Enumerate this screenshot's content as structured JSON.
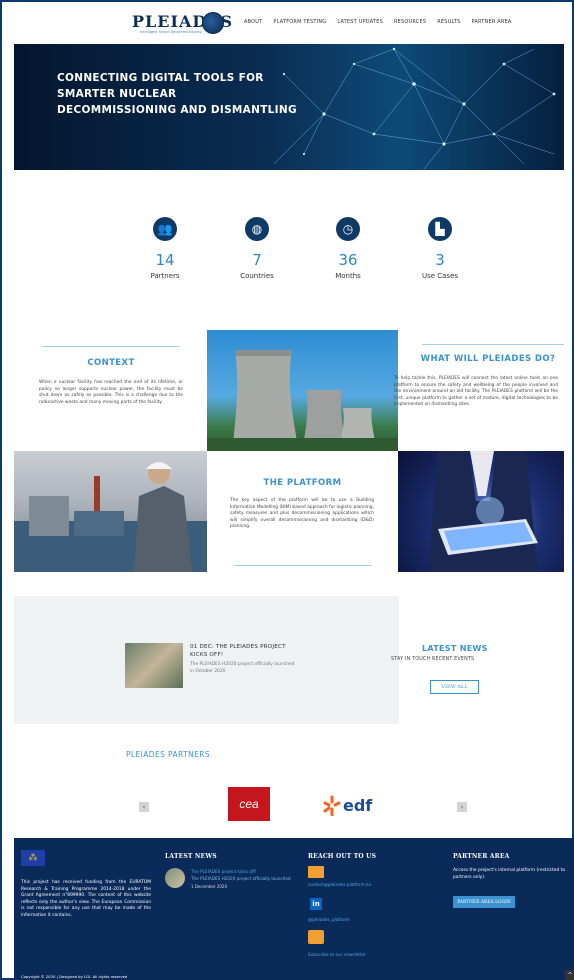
{
  "header": {
    "logo_text": "PLEIADES",
    "logo_tagline": "Intelligent Smart Decommissioning",
    "nav": [
      "ABOUT",
      "PLATFORM TESTING",
      "LATEST UPDATES",
      "RESOURCES",
      "RESULTS",
      "PARTNER AREA"
    ]
  },
  "hero": {
    "title": "CONNECTING DIGITAL TOOLS FOR SMARTER NUCLEAR DECOMMISSIONING AND DISMANTLING"
  },
  "stats": [
    {
      "icon": "people-icon",
      "num": "14",
      "label": "Partners"
    },
    {
      "icon": "globe-icon",
      "num": "7",
      "label": "Countries"
    },
    {
      "icon": "clock-icon",
      "num": "36",
      "label": "Months"
    },
    {
      "icon": "factory-icon",
      "num": "3",
      "label": "Use Cases"
    }
  ],
  "context": {
    "title": "CONTEXT",
    "text": "When a nuclear facility has reached the end of its lifetime, or policy no longer supports nuclear power, the facility must be shut down as safely as possible. This is a challenge due to the radioactive waste and many moving parts of the facility."
  },
  "what": {
    "title": "WHAT WILL PLEIADES DO?",
    "text": "To help tackle this, PLEIADES will connect the latest online tools on one platform to ensure the safety and wellbeing of the people involved and the environment around an old facility. The PLEIADES platform will be the first, unique platform to gather a set of mature, digital technologies to be implemented on dismantling sites."
  },
  "platform": {
    "title": "THE PLATFORM",
    "text": "The key aspect of the platform will be to use a Building Information Modelling (BIM) based approach for logistic planning, safety measures and plus decommissioning applications which will simplify overall decommissioning and dismantling (D&D) planning."
  },
  "news": {
    "item_title": "01 DEC: THE PLEIADES PROJECT KICKS OFF!",
    "item_text": "The PLEIADES H2020 project officially launched in October 2020",
    "section_title": "LATEST NEWS",
    "section_sub": "STAY IN TOUCH RECENT EVENTS",
    "view_all": "VIEW ALL"
  },
  "partners": {
    "title": "PLEIADES PARTNERS",
    "logo1": "cea",
    "logo2": "edf",
    "prev": "‹",
    "next": "›"
  },
  "footer": {
    "eu_text": "This project has received funding from the EURATOM Research & Training Programme 2014-2018 under the Grant Agreement n°899990. The content of this website reflects only the author's view. The European Commission is not responsible for any use that may be made of the information it contains.",
    "latest_title": "LATEST NEWS",
    "latest_item_title": "The PLEIADES project kicks off!",
    "latest_item_text": "The PLEIADES H2020 project officially launched",
    "latest_item_date": "1 December 2020",
    "reach_title": "REACH OUT TO US",
    "email": "contact@pleiades-platform.eu",
    "linkedin": "@pleiades_platform",
    "newsletter": "Subscribe to our newsletter",
    "partner_title": "PARTNER AREA",
    "partner_text": "Access the project's internal platform (restricted to partners only).",
    "partner_btn": "PARTNER AREA LOGIN",
    "copyright": "Copyright © 2020 | Designed by LGI. All rights reserved"
  },
  "colors": {
    "accent": "#3a93d0",
    "navy": "#0a2a5a",
    "dark": "#0f3a66"
  }
}
